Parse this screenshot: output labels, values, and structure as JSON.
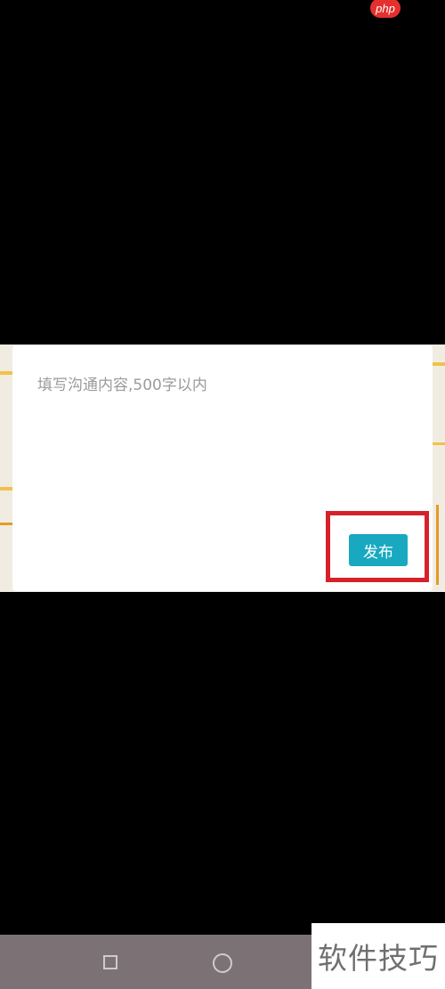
{
  "watermark": {
    "text": "php"
  },
  "dialog": {
    "input_placeholder": "填写沟通内容,500字以内",
    "publish_label": "发布"
  },
  "navbar": {
    "recent_icon": "square-icon",
    "home_icon": "circle-icon"
  },
  "brand_watermark": {
    "text": "软件技巧"
  },
  "colors": {
    "accent": "#18a9c1",
    "highlight": "#d6212b",
    "navbar": "#7c7276"
  }
}
